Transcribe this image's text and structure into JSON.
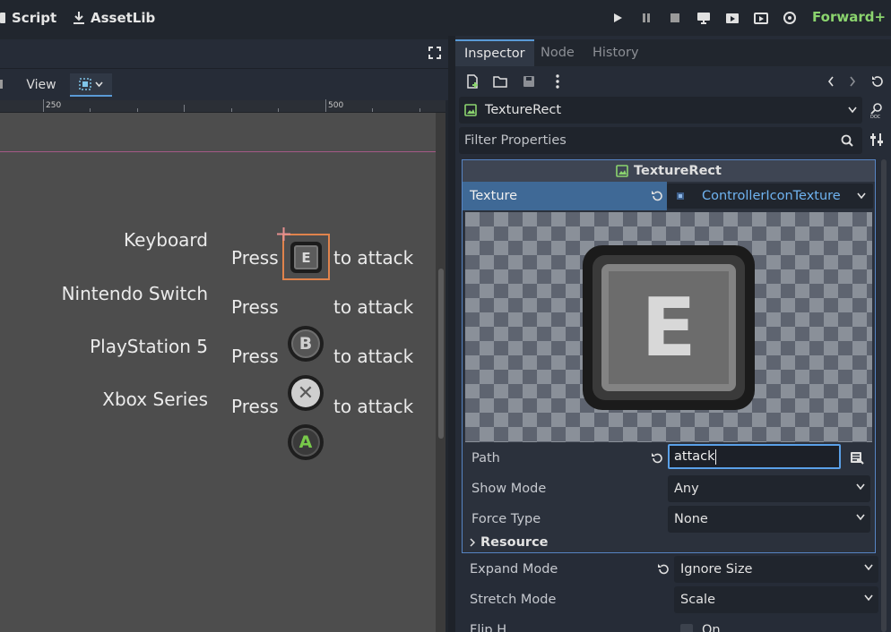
{
  "topbar": {
    "script_label": "Script",
    "assetlib_label": "AssetLib",
    "renderer_label": "Forward+",
    "play_buttons": [
      "play-icon",
      "pause-icon",
      "stop-icon",
      "remote-debug-icon",
      "play-scene-icon",
      "play-custom-icon",
      "movie-icon"
    ]
  },
  "viewport": {
    "view_menu_label": "View",
    "ruler": {
      "labels": [
        "250",
        "500"
      ]
    },
    "rows": [
      {
        "platform": "Keyboard",
        "press": "Press",
        "glyph": "E",
        "to_attack": "to attack"
      },
      {
        "platform": "Nintendo Switch",
        "press": "Press",
        "glyph": "B",
        "to_attack": "to attack"
      },
      {
        "platform": "PlayStation 5",
        "press": "Press",
        "glyph": "✕",
        "to_attack": "to attack"
      },
      {
        "platform": "Xbox Series",
        "press": "Press",
        "glyph": "A",
        "to_attack": "to attack"
      }
    ]
  },
  "inspector": {
    "tabs": [
      "Inspector",
      "Node",
      "History"
    ],
    "active_tab": "Inspector",
    "object_name": "TextureRect",
    "filter_placeholder": "Filter Properties",
    "section_title": "TextureRect",
    "texture": {
      "label": "Texture",
      "value": "ControllerIconTexture",
      "preview_glyph": "E"
    },
    "properties": [
      {
        "label": "Path",
        "value": "attack"
      },
      {
        "label": "Show Mode",
        "value": "Any"
      },
      {
        "label": "Force Type",
        "value": "None"
      }
    ],
    "resource_label": "Resource",
    "outer_properties": [
      {
        "label": "Expand Mode",
        "value": "Ignore Size"
      },
      {
        "label": "Stretch Mode",
        "value": "Scale"
      },
      {
        "label": "Flip H",
        "value": "On"
      }
    ]
  },
  "colors": {
    "accent": "#5a9ad7",
    "renderer": "#8bd46e",
    "selection": "#e0834c"
  }
}
